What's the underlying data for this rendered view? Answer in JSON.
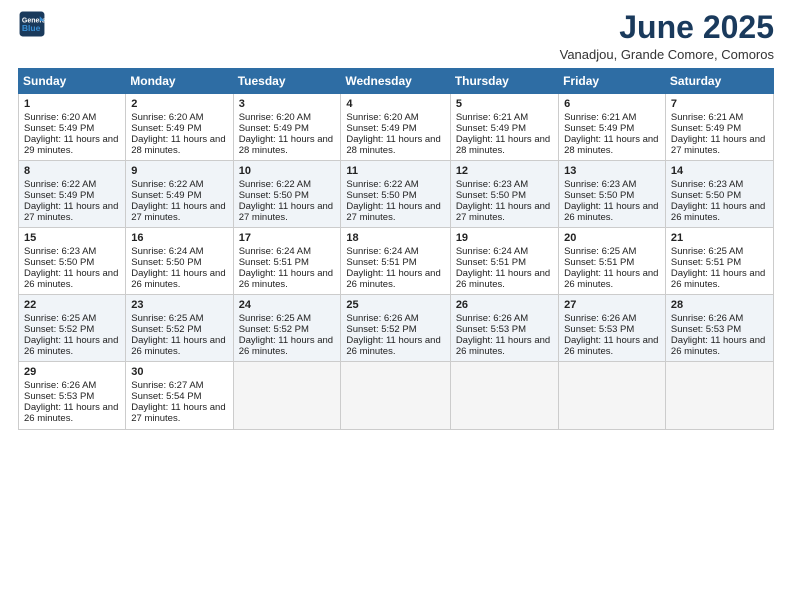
{
  "header": {
    "logo_line1": "General",
    "logo_line2": "Blue",
    "month_year": "June 2025",
    "location": "Vanadjou, Grande Comore, Comoros"
  },
  "days_of_week": [
    "Sunday",
    "Monday",
    "Tuesday",
    "Wednesday",
    "Thursday",
    "Friday",
    "Saturday"
  ],
  "weeks": [
    [
      {
        "day": "1",
        "sunrise": "6:20 AM",
        "sunset": "5:49 PM",
        "daylight": "11 hours and 29 minutes."
      },
      {
        "day": "2",
        "sunrise": "6:20 AM",
        "sunset": "5:49 PM",
        "daylight": "11 hours and 28 minutes."
      },
      {
        "day": "3",
        "sunrise": "6:20 AM",
        "sunset": "5:49 PM",
        "daylight": "11 hours and 28 minutes."
      },
      {
        "day": "4",
        "sunrise": "6:20 AM",
        "sunset": "5:49 PM",
        "daylight": "11 hours and 28 minutes."
      },
      {
        "day": "5",
        "sunrise": "6:21 AM",
        "sunset": "5:49 PM",
        "daylight": "11 hours and 28 minutes."
      },
      {
        "day": "6",
        "sunrise": "6:21 AM",
        "sunset": "5:49 PM",
        "daylight": "11 hours and 28 minutes."
      },
      {
        "day": "7",
        "sunrise": "6:21 AM",
        "sunset": "5:49 PM",
        "daylight": "11 hours and 27 minutes."
      }
    ],
    [
      {
        "day": "8",
        "sunrise": "6:22 AM",
        "sunset": "5:49 PM",
        "daylight": "11 hours and 27 minutes."
      },
      {
        "day": "9",
        "sunrise": "6:22 AM",
        "sunset": "5:49 PM",
        "daylight": "11 hours and 27 minutes."
      },
      {
        "day": "10",
        "sunrise": "6:22 AM",
        "sunset": "5:50 PM",
        "daylight": "11 hours and 27 minutes."
      },
      {
        "day": "11",
        "sunrise": "6:22 AM",
        "sunset": "5:50 PM",
        "daylight": "11 hours and 27 minutes."
      },
      {
        "day": "12",
        "sunrise": "6:23 AM",
        "sunset": "5:50 PM",
        "daylight": "11 hours and 27 minutes."
      },
      {
        "day": "13",
        "sunrise": "6:23 AM",
        "sunset": "5:50 PM",
        "daylight": "11 hours and 26 minutes."
      },
      {
        "day": "14",
        "sunrise": "6:23 AM",
        "sunset": "5:50 PM",
        "daylight": "11 hours and 26 minutes."
      }
    ],
    [
      {
        "day": "15",
        "sunrise": "6:23 AM",
        "sunset": "5:50 PM",
        "daylight": "11 hours and 26 minutes."
      },
      {
        "day": "16",
        "sunrise": "6:24 AM",
        "sunset": "5:50 PM",
        "daylight": "11 hours and 26 minutes."
      },
      {
        "day": "17",
        "sunrise": "6:24 AM",
        "sunset": "5:51 PM",
        "daylight": "11 hours and 26 minutes."
      },
      {
        "day": "18",
        "sunrise": "6:24 AM",
        "sunset": "5:51 PM",
        "daylight": "11 hours and 26 minutes."
      },
      {
        "day": "19",
        "sunrise": "6:24 AM",
        "sunset": "5:51 PM",
        "daylight": "11 hours and 26 minutes."
      },
      {
        "day": "20",
        "sunrise": "6:25 AM",
        "sunset": "5:51 PM",
        "daylight": "11 hours and 26 minutes."
      },
      {
        "day": "21",
        "sunrise": "6:25 AM",
        "sunset": "5:51 PM",
        "daylight": "11 hours and 26 minutes."
      }
    ],
    [
      {
        "day": "22",
        "sunrise": "6:25 AM",
        "sunset": "5:52 PM",
        "daylight": "11 hours and 26 minutes."
      },
      {
        "day": "23",
        "sunrise": "6:25 AM",
        "sunset": "5:52 PM",
        "daylight": "11 hours and 26 minutes."
      },
      {
        "day": "24",
        "sunrise": "6:25 AM",
        "sunset": "5:52 PM",
        "daylight": "11 hours and 26 minutes."
      },
      {
        "day": "25",
        "sunrise": "6:26 AM",
        "sunset": "5:52 PM",
        "daylight": "11 hours and 26 minutes."
      },
      {
        "day": "26",
        "sunrise": "6:26 AM",
        "sunset": "5:53 PM",
        "daylight": "11 hours and 26 minutes."
      },
      {
        "day": "27",
        "sunrise": "6:26 AM",
        "sunset": "5:53 PM",
        "daylight": "11 hours and 26 minutes."
      },
      {
        "day": "28",
        "sunrise": "6:26 AM",
        "sunset": "5:53 PM",
        "daylight": "11 hours and 26 minutes."
      }
    ],
    [
      {
        "day": "29",
        "sunrise": "6:26 AM",
        "sunset": "5:53 PM",
        "daylight": "11 hours and 26 minutes."
      },
      {
        "day": "30",
        "sunrise": "6:27 AM",
        "sunset": "5:54 PM",
        "daylight": "11 hours and 27 minutes."
      },
      null,
      null,
      null,
      null,
      null
    ]
  ]
}
